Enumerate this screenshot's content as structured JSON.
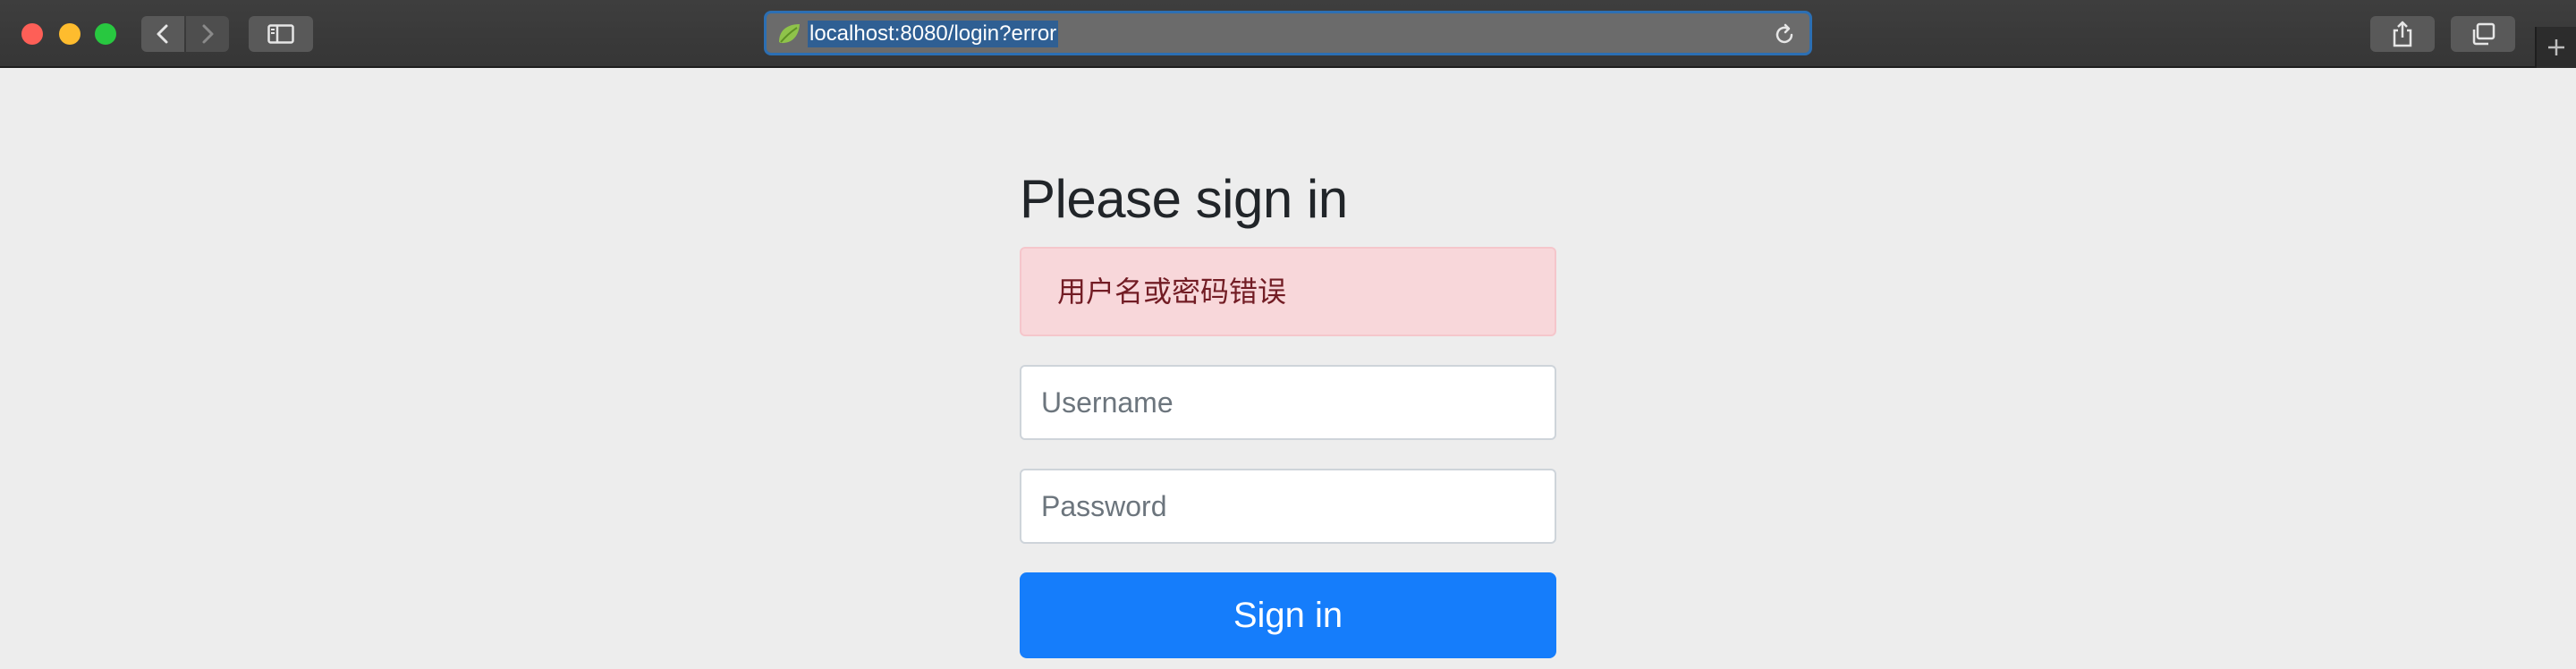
{
  "browser": {
    "url": "localhost:8080/login?error",
    "icons": {
      "close": "traffic-light-close",
      "minimize": "traffic-light-minimize",
      "zoom": "traffic-light-zoom",
      "back": "chevron-left-icon",
      "forward": "chevron-right-icon",
      "sidebar": "sidebar-icon",
      "favicon": "spring-leaf-icon",
      "reload": "reload-icon",
      "share": "share-icon",
      "tabs": "tabs-overview-icon",
      "new_tab": "plus-icon"
    }
  },
  "login": {
    "heading": "Please sign in",
    "error_message": "用户名或密码错误",
    "username_placeholder": "Username",
    "password_placeholder": "Password",
    "submit_label": "Sign in"
  },
  "colors": {
    "accent": "#157dfb",
    "alert_background": "#f8d7da",
    "alert_text": "#721c24",
    "page_background": "#ededed"
  }
}
